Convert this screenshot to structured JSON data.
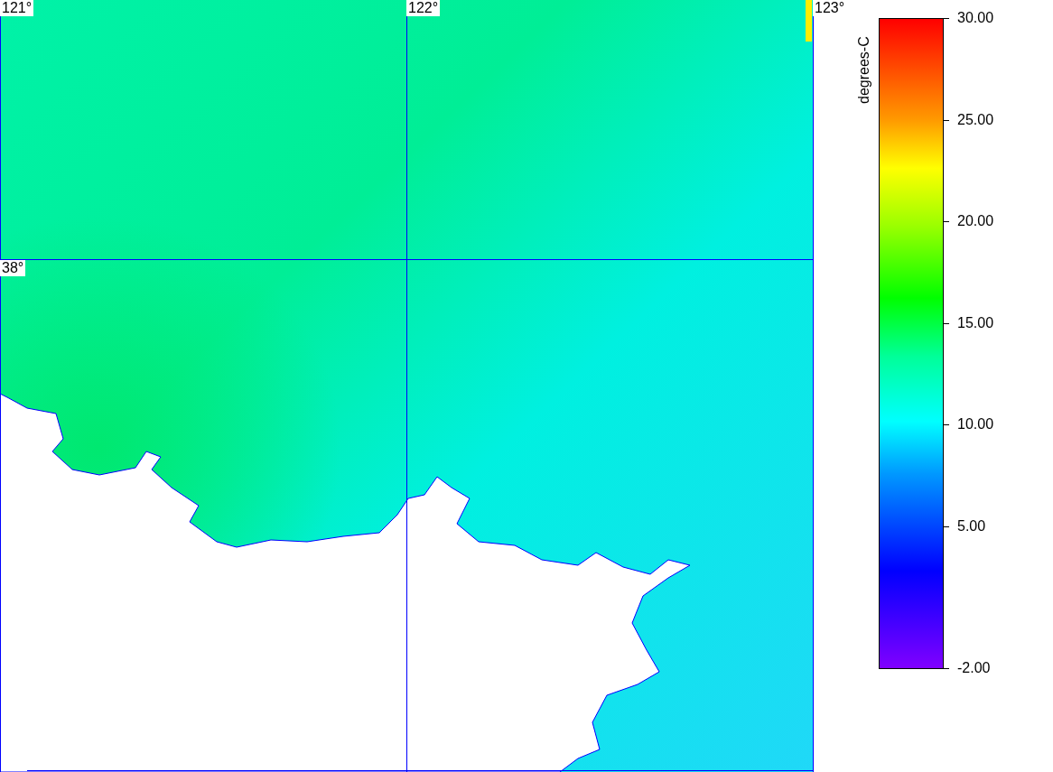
{
  "map": {
    "longitude_labels": [
      "121°",
      "122°",
      "123°"
    ],
    "latitude_labels": [
      "38°"
    ]
  },
  "colorbar": {
    "title": "degrees-C",
    "ticks": [
      "30.00",
      "25.00",
      "20.00",
      "15.00",
      "10.00",
      "5.00",
      "-2.00"
    ]
  }
}
